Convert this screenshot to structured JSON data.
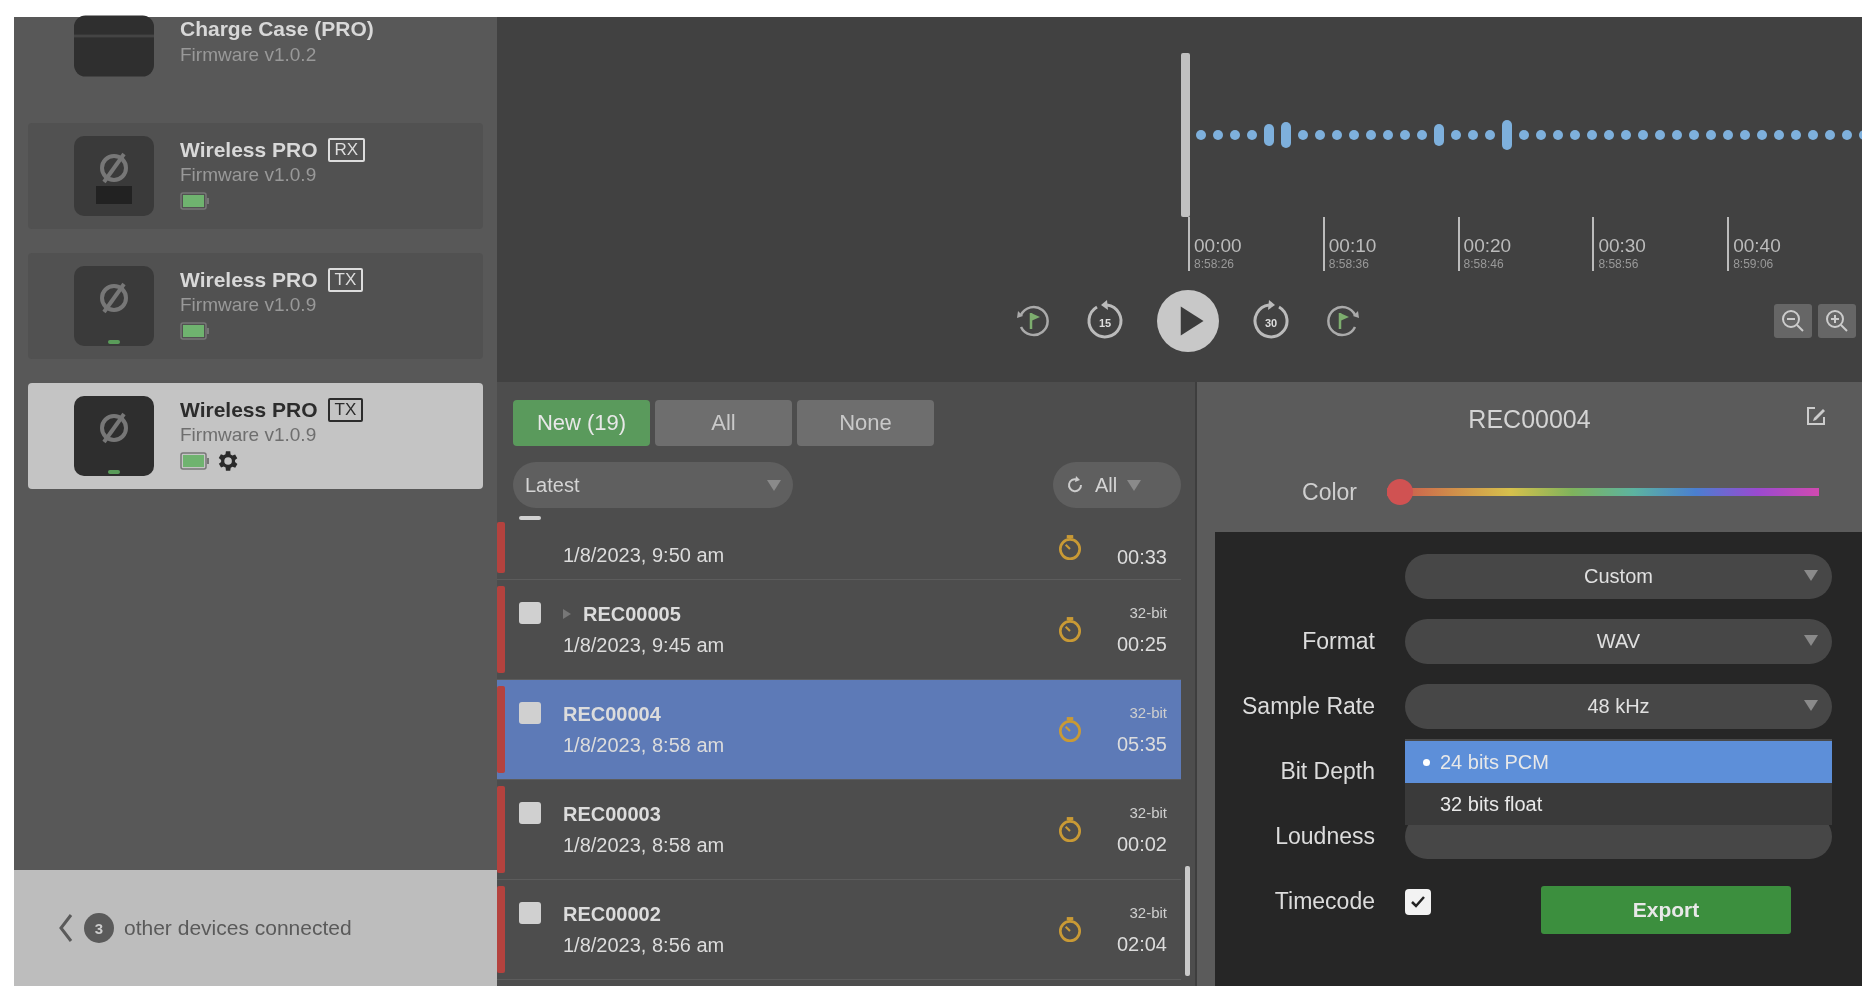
{
  "sidebar": {
    "devices": [
      {
        "kind": "case",
        "name": "Charge Case (PRO)",
        "firmware": "Firmware v1.0.2",
        "selected": false
      },
      {
        "kind": "rx",
        "name": "Wireless PRO",
        "tag": "RX",
        "firmware": "Firmware v1.0.9",
        "selected": false,
        "settings": false
      },
      {
        "kind": "tx",
        "name": "Wireless PRO",
        "tag": "TX",
        "firmware": "Firmware v1.0.9",
        "selected": false,
        "settings": false
      },
      {
        "kind": "tx",
        "name": "Wireless PRO",
        "tag": "TX",
        "firmware": "Firmware v1.0.9",
        "selected": true,
        "settings": true
      }
    ],
    "footer": {
      "count": "3",
      "text": "other devices connected"
    }
  },
  "player": {
    "timeline": [
      {
        "time": "00:00",
        "clock": "8:58:26"
      },
      {
        "time": "00:10",
        "clock": "8:58:36"
      },
      {
        "time": "00:20",
        "clock": "8:58:46"
      },
      {
        "time": "00:30",
        "clock": "8:58:56"
      },
      {
        "time": "00:40",
        "clock": "8:59:06"
      }
    ],
    "skip_back": "15",
    "skip_forward": "30"
  },
  "recordings": {
    "filters": [
      {
        "label": "New (19)",
        "selected": true
      },
      {
        "label": "All",
        "selected": false
      },
      {
        "label": "None",
        "selected": false
      }
    ],
    "sort": "Latest",
    "type_filter": "All",
    "rows": [
      {
        "date": "1/8/2023, 9:50 am",
        "duration": "00:33",
        "color": "#b4423e",
        "checked": false,
        "selected": false
      },
      {
        "name": "REC00005",
        "date": "1/8/2023, 9:45 am",
        "bits": "32-bit",
        "duration": "00:25",
        "color": "#b4423e",
        "checked": false,
        "expandable": true,
        "selected": false
      },
      {
        "name": "REC00004",
        "date": "1/8/2023, 8:58 am",
        "bits": "32-bit",
        "duration": "05:35",
        "color": "#b4423e",
        "checked": false,
        "expandable": false,
        "selected": true
      },
      {
        "name": "REC00003",
        "date": "1/8/2023, 8:58 am",
        "bits": "32-bit",
        "duration": "00:02",
        "color": "#b4423e",
        "checked": false,
        "expandable": false,
        "selected": false
      },
      {
        "name": "REC00002",
        "date": "1/8/2023, 8:56 am",
        "bits": "32-bit",
        "duration": "02:04",
        "color": "#b4423e",
        "checked": false,
        "expandable": false,
        "selected": false
      }
    ]
  },
  "detail": {
    "title": "REC00004",
    "color": {
      "label": "Color",
      "level": 0
    },
    "preset": "Custom",
    "fields": [
      {
        "kind": "select",
        "label": "Format",
        "value": "WAV"
      },
      {
        "kind": "select",
        "label": "Sample Rate",
        "value": "48 kHz"
      },
      {
        "kind": "menu",
        "label": "Bit Depth",
        "options": [
          {
            "label": "24 bits PCM",
            "selected": true
          },
          {
            "label": "32 bits float",
            "selected": false
          }
        ]
      },
      {
        "kind": "covered",
        "label": "Loudness"
      },
      {
        "kind": "checkbox",
        "label": "Timecode",
        "checked": true
      }
    ],
    "export": "Export"
  }
}
